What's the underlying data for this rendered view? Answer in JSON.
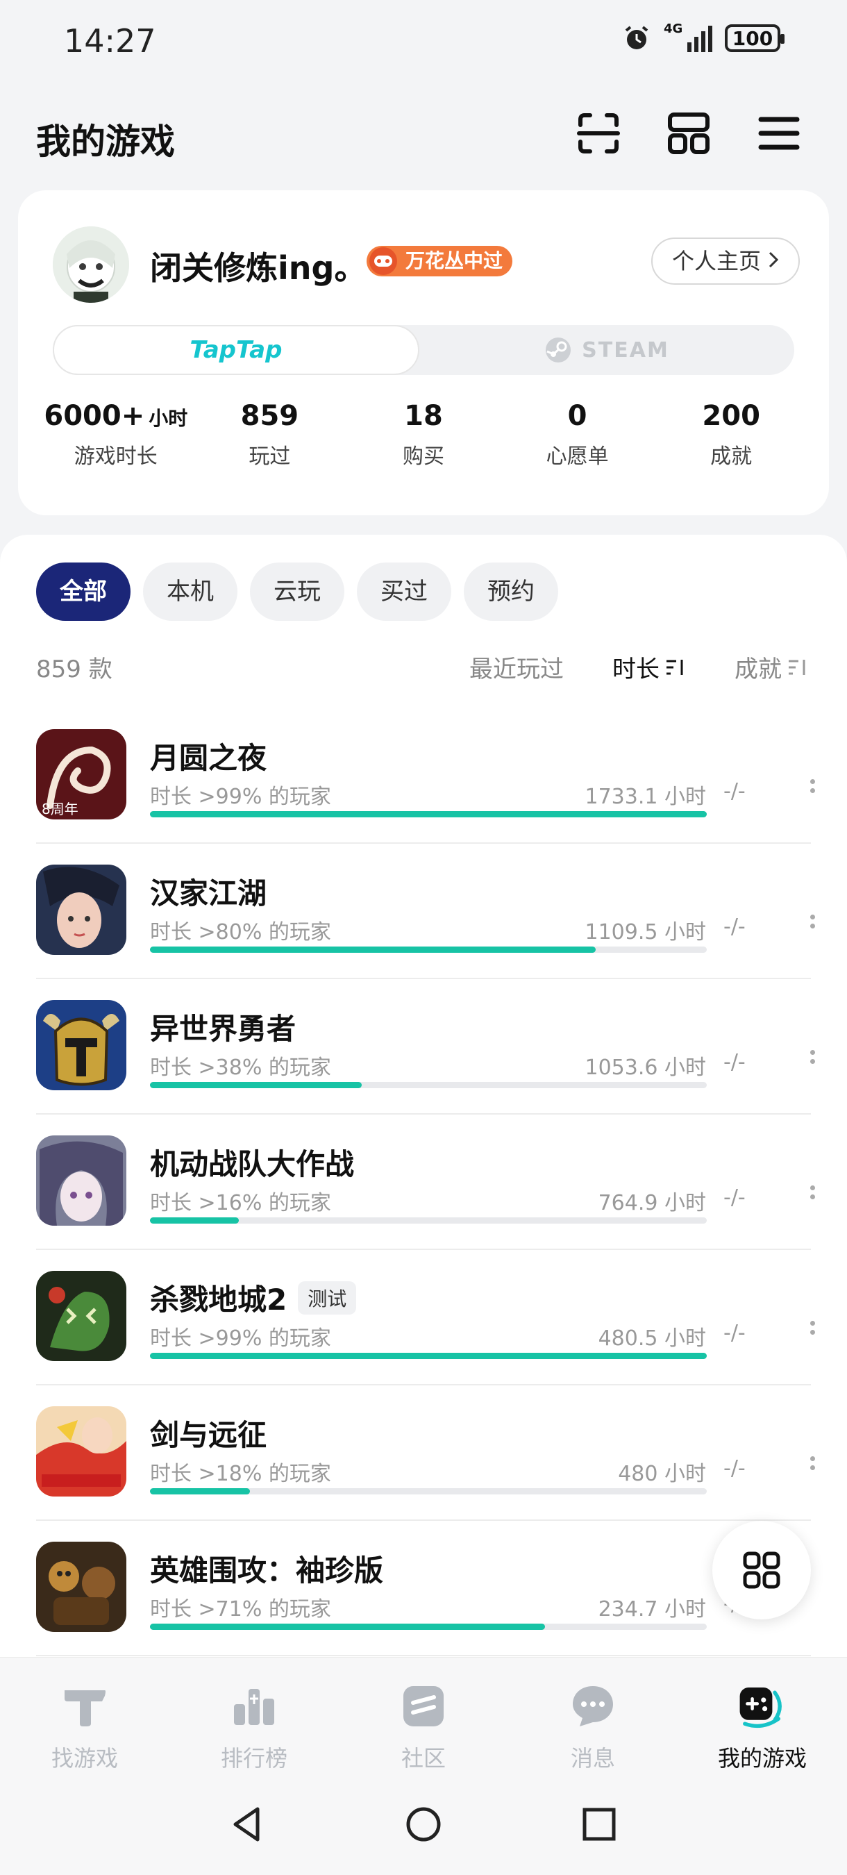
{
  "status_bar": {
    "time": "14:27",
    "network": "4G",
    "battery": "100"
  },
  "header": {
    "title": "我的游戏",
    "icons": [
      "scan-icon",
      "grid-icon",
      "menu-icon"
    ]
  },
  "profile": {
    "name": "闭关修炼ing。",
    "badge": "万花丛中过",
    "home_button": "个人主页",
    "platforms": {
      "taptap": "TapTap",
      "steam": "STEAM",
      "selected": "TapTap"
    },
    "stats": [
      {
        "value": "6000+",
        "unit": "小时",
        "label": "游戏时长"
      },
      {
        "value": "859",
        "unit": "",
        "label": "玩过"
      },
      {
        "value": "18",
        "unit": "",
        "label": "购买"
      },
      {
        "value": "0",
        "unit": "",
        "label": "心愿单"
      },
      {
        "value": "200",
        "unit": "",
        "label": "成就"
      }
    ]
  },
  "filters": {
    "chips": [
      "全部",
      "本机",
      "云玩",
      "买过",
      "预约"
    ],
    "active": "全部"
  },
  "list": {
    "count": "859 款",
    "sort": {
      "recent": "最近玩过",
      "duration": "时长",
      "achievement": "成就",
      "active": "时长"
    },
    "games": [
      {
        "name": "月圆之夜",
        "tag": "",
        "percentile": "时长 >99% 的玩家",
        "hours": "1733.1 小时",
        "progress": 1.0,
        "achievement": "-/-",
        "icon_badge": "8周年",
        "icon_colors": [
          "#3a0c10",
          "#8c1c22"
        ]
      },
      {
        "name": "汉家江湖",
        "tag": "",
        "percentile": "时长 >80% 的玩家",
        "hours": "1109.5 小时",
        "progress": 0.8,
        "achievement": "-/-",
        "icon_badge": "",
        "icon_colors": [
          "#2b3a5a",
          "#d9b8a8"
        ]
      },
      {
        "name": "异世界勇者",
        "tag": "",
        "percentile": "时长 >38% 的玩家",
        "hours": "1053.6 小时",
        "progress": 0.38,
        "achievement": "-/-",
        "icon_badge": "",
        "icon_colors": [
          "#1b3a78",
          "#c79a2c"
        ]
      },
      {
        "name": "机动战队大作战",
        "tag": "",
        "percentile": "时长 >16% 的玩家",
        "hours": "764.9 小时",
        "progress": 0.16,
        "achievement": "-/-",
        "icon_badge": "",
        "icon_colors": [
          "#5a5f7a",
          "#c9c3d8"
        ]
      },
      {
        "name": "杀戮地城2",
        "tag": "测试",
        "percentile": "时长 >99% 的玩家",
        "hours": "480.5 小时",
        "progress": 1.0,
        "achievement": "-/-",
        "icon_badge": "",
        "icon_colors": [
          "#1f2a1a",
          "#4f8f3a"
        ]
      },
      {
        "name": "剑与远征",
        "tag": "",
        "percentile": "时长 >18% 的玩家",
        "hours": "480 小时",
        "progress": 0.18,
        "achievement": "-/-",
        "icon_badge": "",
        "icon_colors": [
          "#f2d7b0",
          "#d83a2a"
        ]
      },
      {
        "name": "英雄围攻：袖珍版",
        "tag": "",
        "percentile": "时长 >71% 的玩家",
        "hours": "234.7 小时",
        "progress": 0.71,
        "achievement": "-/-",
        "icon_badge": "",
        "icon_colors": [
          "#3a2a1a",
          "#c08a3a"
        ]
      }
    ]
  },
  "bottom_nav": {
    "items": [
      {
        "label": "找游戏",
        "icon": "taptap-icon"
      },
      {
        "label": "排行榜",
        "icon": "ranking-icon"
      },
      {
        "label": "社区",
        "icon": "community-icon"
      },
      {
        "label": "消息",
        "icon": "message-icon"
      },
      {
        "label": "我的游戏",
        "icon": "gamepad-icon"
      }
    ],
    "active": "我的游戏"
  },
  "colors": {
    "accent": "#17c3a5",
    "chip_active": "#1b2678",
    "taptap": "#15c5ce",
    "badge": "#f37a3c"
  }
}
